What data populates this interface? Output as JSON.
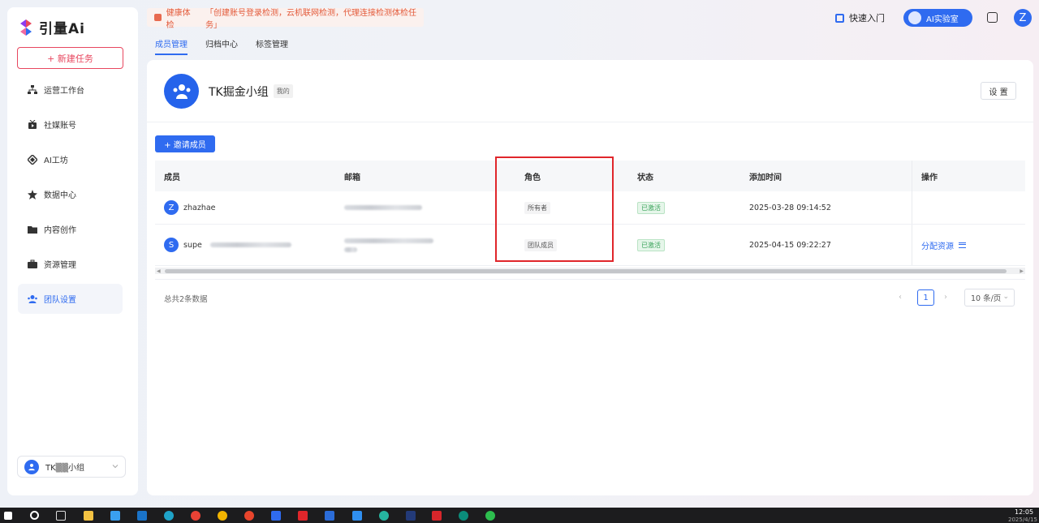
{
  "app": {
    "logo_text": "引量Ai",
    "new_task_label": "+ 新建任务"
  },
  "sidebar": {
    "items": [
      {
        "label": "运营工作台",
        "icon": "org-chart-icon"
      },
      {
        "label": "社媒账号",
        "icon": "video-icon"
      },
      {
        "label": "AI工坊",
        "icon": "diamond-icon"
      },
      {
        "label": "数据中心",
        "icon": "star-burst-icon"
      },
      {
        "label": "内容创作",
        "icon": "folder-icon"
      },
      {
        "label": "资源管理",
        "icon": "briefcase-icon"
      },
      {
        "label": "团队设置",
        "icon": "team-icon",
        "active": true
      }
    ],
    "team_switch_label": "TK▒▒小组"
  },
  "header": {
    "health_title": "健康体检",
    "health_message": "「创建账号登录检测，云机联网检测，代理连接检测体检任务」",
    "quick_entry": "快速入门",
    "ai_lab": "AI实验室",
    "avatar_letter": "Z"
  },
  "tabs": [
    {
      "label": "成员管理",
      "active": true
    },
    {
      "label": "归档中心"
    },
    {
      "label": "标签管理"
    }
  ],
  "team": {
    "name": "TK掘金小组",
    "tag": "我的",
    "settings_label": "设 置"
  },
  "invite_label": "+ 邀请成员",
  "table": {
    "columns": [
      "成员",
      "邮箱",
      "角色",
      "状态",
      "添加时间",
      "操作"
    ],
    "rows": [
      {
        "avatar": "Z",
        "member": "zhazhae",
        "role": "所有者",
        "status": "已激活",
        "added": "2025-03-28 09:14:52",
        "action": ""
      },
      {
        "avatar": "S",
        "member": "supe",
        "role": "团队成员",
        "status": "已激活",
        "added": "2025-04-15 09:22:27",
        "action": "分配资源"
      }
    ]
  },
  "pagination": {
    "total": "总共2条数据",
    "current": "1",
    "page_size": "10 条/页"
  },
  "taskbar": {
    "time": "12:05",
    "date": "2025/4/15"
  },
  "colors": {
    "primary": "#2f6bf0",
    "danger": "#e8475f",
    "highlight": "#e0262b"
  }
}
